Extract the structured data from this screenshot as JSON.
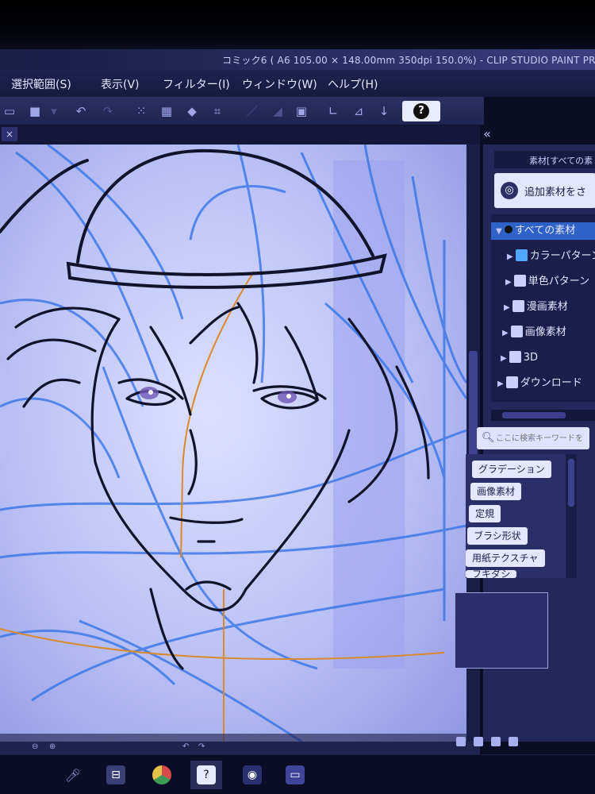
{
  "window": {
    "title": "コミック6 ( A6 105.00 × 148.00mm 350dpi 150.0%) - CLIP STUDIO PAINT PRO"
  },
  "menu": {
    "items": [
      "選択範囲(S)",
      "表示(V)",
      "フィルター(I)",
      "ウィンドウ(W)",
      "ヘルプ(H)"
    ]
  },
  "toolbar": {
    "help_label": "?"
  },
  "canvas_tab": {
    "close_label": "×"
  },
  "panel": {
    "collapse_label": "«",
    "header_title": "素材[すべての素",
    "add_button_label": "追加素材をさ",
    "tree": [
      "すべての素材",
      "カラーパターン",
      "単色パターン",
      "漫画素材",
      "画像素材",
      "3D",
      "ダウンロード"
    ],
    "search_placeholder": "ここに検索キーワードを",
    "tags": [
      "グラデーション",
      "画像素材",
      "定規",
      "ブラシ形状",
      "用紙テクスチャ",
      "フキダシ"
    ]
  },
  "colors": {
    "canvas_bg": "#c4c9f7",
    "lineart": "#11132a",
    "sketch_blue": "#2f6fe6",
    "guide_orange": "#d98a2e",
    "selection_accent": "#2e62c9"
  },
  "icons": {
    "taskbar": [
      "microphone-icon",
      "task-view-icon",
      "chrome-icon",
      "clip-studio-icon",
      "app-icon",
      "folder-icon"
    ]
  }
}
